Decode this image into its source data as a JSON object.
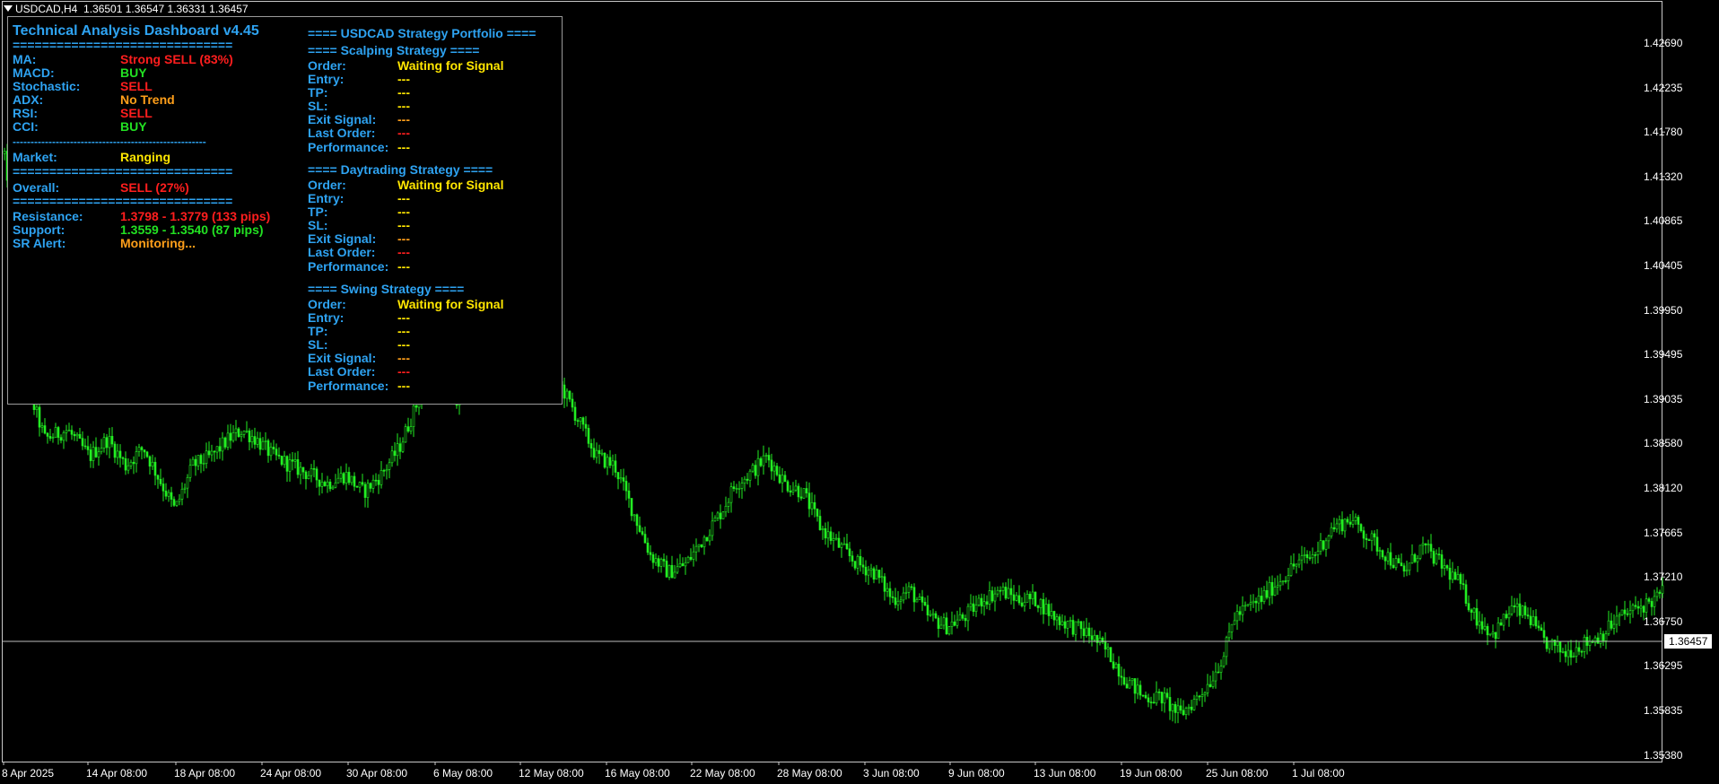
{
  "header": {
    "symbol": "USDCAD,H4",
    "ohlc": "1.36501 1.36547 1.36331 1.36457"
  },
  "price_axis": {
    "labels": [
      "1.42690",
      "1.42235",
      "1.41780",
      "1.41320",
      "1.40865",
      "1.40405",
      "1.39950",
      "1.39495",
      "1.39035",
      "1.38580",
      "1.38120",
      "1.37665",
      "1.37210",
      "1.36750",
      "1.36295",
      "1.35835",
      "1.35380"
    ],
    "current": "1.36457"
  },
  "time_axis": {
    "labels": [
      "8 Apr 2025",
      "14 Apr 08:00",
      "18 Apr 08:00",
      "24 Apr 08:00",
      "30 Apr 08:00",
      "6 May 08:00",
      "12 May 08:00",
      "16 May 08:00",
      "22 May 08:00",
      "28 May 08:00",
      "3 Jun 08:00",
      "9 Jun 08:00",
      "13 Jun 08:00",
      "19 Jun 08:00",
      "25 Jun 08:00",
      "1 Jul 08:00"
    ]
  },
  "colors": {
    "candle": "#22ee22",
    "panel_label": "#2ea3f2",
    "sell": "#ff1e1e",
    "buy": "#22e022",
    "neutral": "#ff9f1a",
    "signal": "#ffe600"
  },
  "dashboard": {
    "title": "Technical Analysis Dashboard v4.45",
    "sep_eq": "==============================",
    "sep_dash": "------------------------------------------------------",
    "indicators": [
      {
        "label": "MA:",
        "value": "Strong SELL (83%)"
      },
      {
        "label": "MACD:",
        "value": "BUY"
      },
      {
        "label": "Stochastic:",
        "value": "SELL"
      },
      {
        "label": "ADX:",
        "value": "No Trend"
      },
      {
        "label": "RSI:",
        "value": "SELL"
      },
      {
        "label": "CCI:",
        "value": "BUY"
      }
    ],
    "market": {
      "label": "Market:",
      "value": "Ranging"
    },
    "overall": {
      "label": "Overall:",
      "value": "SELL (27%)"
    },
    "levels": [
      {
        "label": "Resistance:",
        "value": "1.3798 - 1.3779 (133 pips)"
      },
      {
        "label": "Support:",
        "value": "1.3559 - 1.3540 (87 pips)"
      },
      {
        "label": "SR Alert:",
        "value": "Monitoring..."
      }
    ]
  },
  "portfolio": {
    "title": "==== USDCAD Strategy Portfolio ====",
    "labels": {
      "order": "Order:",
      "entry": "Entry:",
      "tp": "TP:",
      "sl": "SL:",
      "exit": "Exit Signal:",
      "last": "Last Order:",
      "perf": "Performance:"
    },
    "strategies": [
      {
        "title": "==== Scalping Strategy ====",
        "order": "Waiting for Signal",
        "entry": "---",
        "tp": "---",
        "sl": "---",
        "exit": "---",
        "last": "---",
        "perf": "---"
      },
      {
        "title": "==== Daytrading Strategy ====",
        "order": "Waiting for Signal",
        "entry": "---",
        "tp": "---",
        "sl": "---",
        "exit": "---",
        "last": "---",
        "perf": "---"
      },
      {
        "title": "==== Swing Strategy ====",
        "order": "Waiting for Signal",
        "entry": "---",
        "tp": "---",
        "sl": "---",
        "exit": "---",
        "last": "---",
        "perf": "---"
      }
    ]
  },
  "chart_data": {
    "type": "candlestick",
    "ylim": [
      1.3515,
      1.4305
    ],
    "current_price": 1.36457,
    "close_path": [
      [
        0,
        1.418
      ],
      [
        10,
        1.405
      ],
      [
        25,
        1.392
      ],
      [
        45,
        1.386
      ],
      [
        70,
        1.387
      ],
      [
        95,
        1.384
      ],
      [
        115,
        1.386
      ],
      [
        135,
        1.383
      ],
      [
        155,
        1.385
      ],
      [
        175,
        1.381
      ],
      [
        190,
        1.378
      ],
      [
        210,
        1.383
      ],
      [
        230,
        1.384
      ],
      [
        250,
        1.386
      ],
      [
        265,
        1.387
      ],
      [
        280,
        1.386
      ],
      [
        300,
        1.384
      ],
      [
        320,
        1.383
      ],
      [
        340,
        1.382
      ],
      [
        360,
        1.381
      ],
      [
        380,
        1.382
      ],
      [
        400,
        1.38
      ],
      [
        420,
        1.382
      ],
      [
        440,
        1.385
      ],
      [
        460,
        1.39
      ],
      [
        475,
        1.395
      ],
      [
        490,
        1.398
      ],
      [
        505,
        1.39
      ],
      [
        520,
        1.396
      ],
      [
        535,
        1.398
      ],
      [
        555,
        1.395
      ],
      [
        575,
        1.396
      ],
      [
        595,
        1.395
      ],
      [
        615,
        1.393
      ],
      [
        635,
        1.389
      ],
      [
        660,
        1.384
      ],
      [
        680,
        1.383
      ],
      [
        700,
        1.378
      ],
      [
        720,
        1.373
      ],
      [
        740,
        1.371
      ],
      [
        760,
        1.372
      ],
      [
        780,
        1.375
      ],
      [
        800,
        1.378
      ],
      [
        815,
        1.381
      ],
      [
        830,
        1.382
      ],
      [
        850,
        1.384
      ],
      [
        870,
        1.381
      ],
      [
        890,
        1.38
      ],
      [
        910,
        1.376
      ],
      [
        930,
        1.374
      ],
      [
        950,
        1.372
      ],
      [
        970,
        1.371
      ],
      [
        990,
        1.368
      ],
      [
        1010,
        1.369
      ],
      [
        1030,
        1.366
      ],
      [
        1050,
        1.365
      ],
      [
        1070,
        1.366
      ],
      [
        1090,
        1.368
      ],
      [
        1110,
        1.369
      ],
      [
        1130,
        1.368
      ],
      [
        1150,
        1.368
      ],
      [
        1170,
        1.366
      ],
      [
        1190,
        1.365
      ],
      [
        1210,
        1.364
      ],
      [
        1230,
        1.362
      ],
      [
        1250,
        1.359
      ],
      [
        1270,
        1.357
      ],
      [
        1290,
        1.357
      ],
      [
        1310,
        1.355
      ],
      [
        1330,
        1.357
      ],
      [
        1345,
        1.359
      ],
      [
        1360,
        1.362
      ],
      [
        1370,
        1.366
      ],
      [
        1385,
        1.367
      ],
      [
        1400,
        1.368
      ],
      [
        1420,
        1.37
      ],
      [
        1440,
        1.372
      ],
      [
        1460,
        1.373
      ],
      [
        1480,
        1.376
      ],
      [
        1500,
        1.377
      ],
      [
        1520,
        1.375
      ],
      [
        1540,
        1.373
      ],
      [
        1560,
        1.371
      ],
      [
        1580,
        1.374
      ],
      [
        1600,
        1.372
      ],
      [
        1620,
        1.37
      ],
      [
        1640,
        1.366
      ],
      [
        1660,
        1.364
      ],
      [
        1680,
        1.367
      ],
      [
        1700,
        1.366
      ],
      [
        1710,
        1.364
      ],
      [
        1720,
        1.363
      ],
      [
        1740,
        1.362
      ],
      [
        1760,
        1.363
      ],
      [
        1780,
        1.364
      ],
      [
        1800,
        1.366
      ],
      [
        1820,
        1.367
      ],
      [
        1840,
        1.368
      ],
      [
        1850,
        1.369
      ]
    ]
  }
}
